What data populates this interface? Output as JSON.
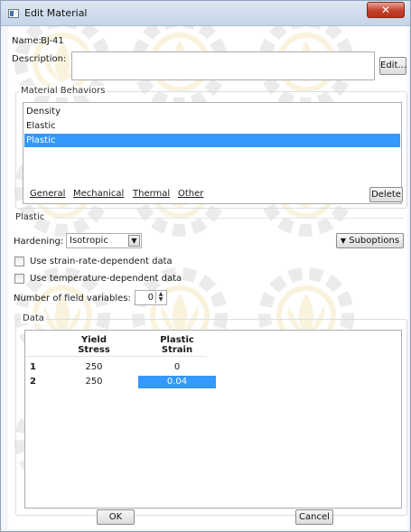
{
  "window": {
    "title": "Edit Material",
    "close_glyph": "✕"
  },
  "material": {
    "name_label": "Name:",
    "name_value": "BJ-41",
    "description_label": "Description:",
    "description_value": "",
    "edit_button": "Edit..."
  },
  "behaviors": {
    "group_label": "Material Behaviors",
    "items": [
      "Density",
      "Elastic",
      "Plastic"
    ],
    "selected_index": 2
  },
  "menu": {
    "tabs": [
      "General",
      "Mechanical",
      "Thermal",
      "Other"
    ],
    "delete_button": "Delete"
  },
  "plastic": {
    "section_label": "Plastic",
    "hardening_label": "Hardening:",
    "hardening_value": "Isotropic",
    "suboptions_button": "Suboptions",
    "strain_rate_label": "Use strain-rate-dependent data",
    "strain_rate_checked": false,
    "temperature_label": "Use temperature-dependent data",
    "temperature_checked": false,
    "field_variables_label": "Number of field variables:",
    "field_variables_value": "0"
  },
  "data_table": {
    "group_label": "Data",
    "columns": [
      {
        "line1": "Yield",
        "line2": "Stress"
      },
      {
        "line1": "Plastic",
        "line2": "Strain"
      }
    ],
    "rows": [
      {
        "index": "1",
        "cells": [
          "250",
          "0"
        ]
      },
      {
        "index": "2",
        "cells": [
          "250",
          "0.04"
        ]
      }
    ],
    "selected_cell": {
      "row": 1,
      "col": 1
    }
  },
  "footer": {
    "ok_button": "OK",
    "cancel_button": "Cancel"
  },
  "colors": {
    "selection": "#3399ff",
    "watermark": "#e0b93a",
    "close_button": "#c4402b"
  }
}
